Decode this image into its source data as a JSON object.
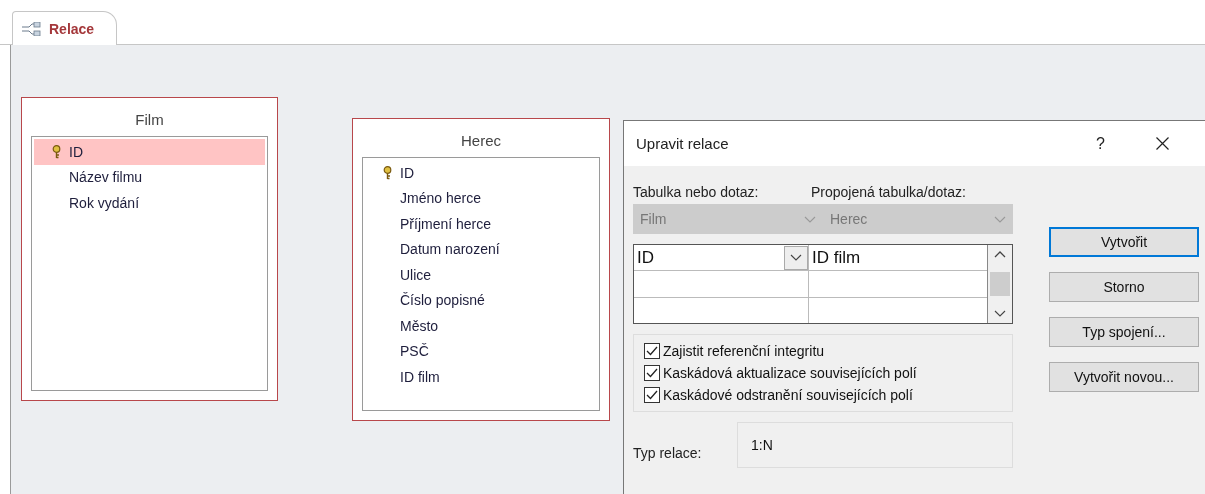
{
  "tab": {
    "label": "Relace",
    "selected": true
  },
  "tables": [
    {
      "title": "Film",
      "fields": [
        {
          "name": "ID",
          "primary_key": true,
          "selected": true
        },
        {
          "name": "Název filmu",
          "primary_key": false,
          "selected": false
        },
        {
          "name": "Rok vydání",
          "primary_key": false,
          "selected": false
        }
      ]
    },
    {
      "title": "Herec",
      "fields": [
        {
          "name": "ID",
          "primary_key": true,
          "selected": false
        },
        {
          "name": "Jméno herce",
          "primary_key": false,
          "selected": false
        },
        {
          "name": "Příjmení herce",
          "primary_key": false,
          "selected": false
        },
        {
          "name": "Datum narození",
          "primary_key": false,
          "selected": false
        },
        {
          "name": "Ulice",
          "primary_key": false,
          "selected": false
        },
        {
          "name": "Číslo popisné",
          "primary_key": false,
          "selected": false
        },
        {
          "name": "Město",
          "primary_key": false,
          "selected": false
        },
        {
          "name": "PSČ",
          "primary_key": false,
          "selected": false
        },
        {
          "name": "ID film",
          "primary_key": false,
          "selected": false
        }
      ]
    }
  ],
  "dialog": {
    "title": "Upravit relace",
    "help": "?",
    "table_label": "Tabulka nebo dotaz:",
    "related_label": "Propojená tabulka/dotaz:",
    "table_combo": {
      "value": "Film",
      "disabled": true
    },
    "related_combo": {
      "value": "Herec",
      "disabled": true
    },
    "grid_rows": [
      {
        "left": "ID",
        "right": "ID film"
      }
    ],
    "checkboxes": [
      {
        "label": "Zajistit referenční integritu",
        "checked": true
      },
      {
        "label": "Kaskádová aktualizace souvisejících polí",
        "checked": true
      },
      {
        "label": "Kaskádové odstranění souvisejících polí",
        "checked": true
      }
    ],
    "type_label": "Typ relace:",
    "type_value": "1:N",
    "buttons": [
      {
        "label": "Vytvořit",
        "focused": true
      },
      {
        "label": "Storno",
        "focused": false
      },
      {
        "label": "Typ spojení...",
        "focused": false
      },
      {
        "label": "Vytvořit novou...",
        "focused": false
      }
    ]
  }
}
